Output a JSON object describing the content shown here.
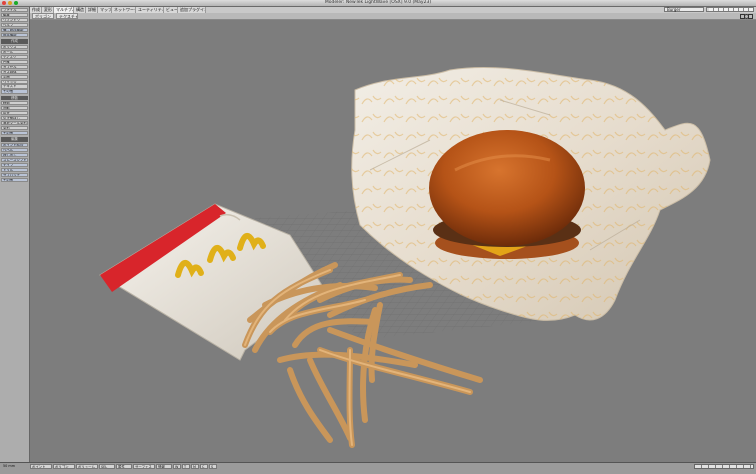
{
  "window": {
    "title": "Modeler: NewTek LightWave [OSX] 9.0 (May23)"
  },
  "tabs": [
    {
      "label": "作成"
    },
    {
      "label": "変形"
    },
    {
      "label": "マルチプル"
    },
    {
      "label": "構造"
    },
    {
      "label": "詳細"
    },
    {
      "label": "マップ"
    },
    {
      "label": "ネットワーク"
    },
    {
      "label": "ユーティリティ"
    },
    {
      "label": "ビュー"
    },
    {
      "label": "追加プラグイン"
    }
  ],
  "layer_select": {
    "value": "Burger"
  },
  "view_selects": [
    {
      "value": "ポリゴン"
    },
    {
      "value": "テクスチャ"
    }
  ],
  "sidebar": {
    "top": [
      {
        "label": "ファイル"
      },
      {
        "label": "編集"
      },
      {
        "label": "ウィンドウ"
      },
      {
        "label": "ヘルプ"
      }
    ],
    "group1": [
      {
        "label": "偏 - 既存機能"
      },
      {
        "label": "既存機能"
      }
    ],
    "section2": "作成",
    "group2": [
      {
        "label": "ボックス"
      },
      {
        "label": "ボール"
      },
      {
        "label": "ディスク"
      },
      {
        "label": "円錐"
      },
      {
        "label": "カプセル"
      },
      {
        "label": "ガス球体"
      },
      {
        "label": "平面"
      },
      {
        "label": "ウェッジ"
      },
      {
        "label": "テキスト"
      },
      {
        "label": "その他"
      }
    ],
    "section3": "移動",
    "group3": [
      {
        "label": "移動"
      },
      {
        "label": "回転"
      },
      {
        "label": "拡大"
      },
      {
        "label": "引き伸ばし"
      },
      {
        "label": "選択ツール変形"
      },
      {
        "label": "変形"
      },
      {
        "label": "その他"
      }
    ],
    "section4": "編集",
    "group4": [
      {
        "label": "ポイント結合"
      },
      {
        "label": "ベベル"
      },
      {
        "label": "押し出し"
      },
      {
        "label": "スムースシフト"
      },
      {
        "label": "ナイフ"
      },
      {
        "label": "ドリル"
      },
      {
        "label": "サブパッチ"
      },
      {
        "label": "その他"
      }
    ]
  },
  "bottombar": {
    "items": [
      {
        "label": "ポイント"
      },
      {
        "label": "ポリゴン"
      },
      {
        "label": "ボリューム"
      },
      {
        "label": "SEL"
      },
      {
        "label": "属性"
      },
      {
        "label": "サーフェス"
      },
      {
        "label": "情報"
      },
      {
        "label": "W"
      },
      {
        "label": "T"
      },
      {
        "label": "M"
      },
      {
        "label": "C"
      },
      {
        "label": "S"
      }
    ],
    "grid": "50 mm"
  }
}
